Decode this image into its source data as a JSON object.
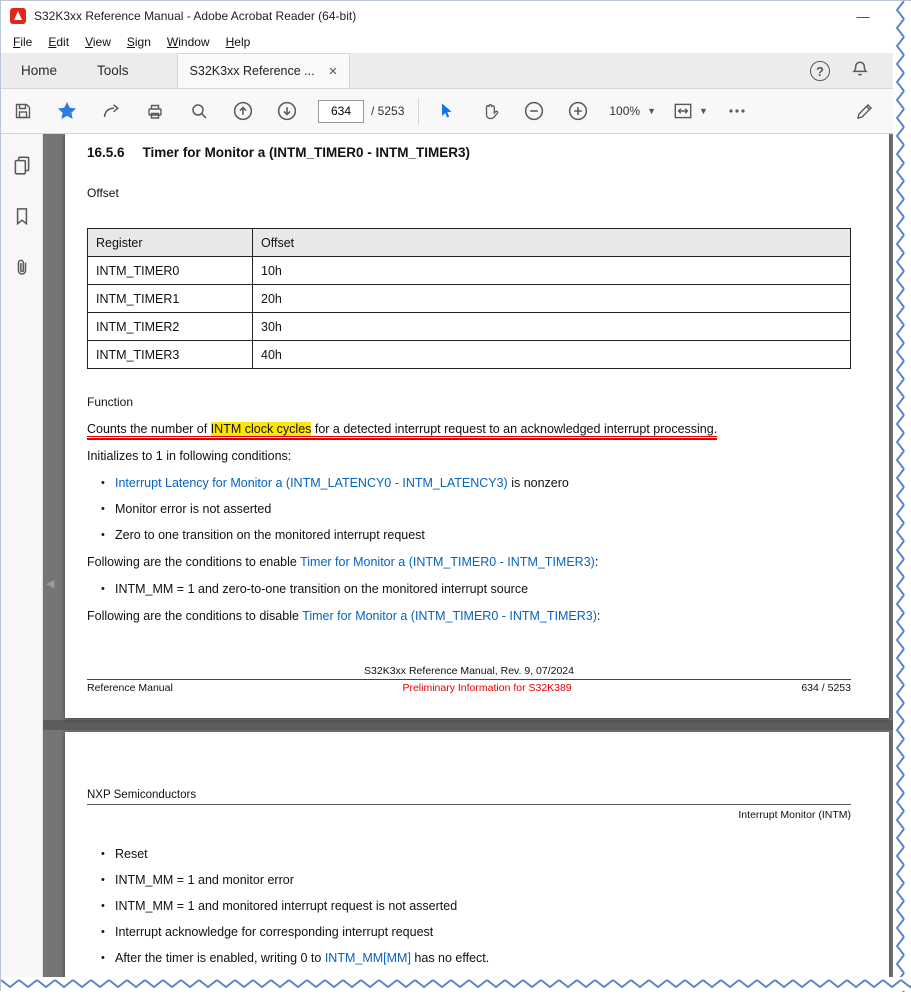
{
  "window": {
    "title": "S32K3xx Reference Manual - Adobe Acrobat Reader (64-bit)"
  },
  "menu": {
    "items": [
      "File",
      "Edit",
      "View",
      "Sign",
      "Window",
      "Help"
    ]
  },
  "tabs": {
    "home": "Home",
    "tools": "Tools",
    "document": "S32K3xx Reference ..."
  },
  "toolbar": {
    "page_current": "634",
    "page_total": "/ 5253",
    "zoom_level": "100%"
  },
  "sidebar": {
    "icons": [
      "page-thumbnails",
      "bookmarks",
      "attachments"
    ]
  },
  "page1": {
    "heading_number": "16.5.6",
    "heading_title": "Timer for Monitor a (INTM_TIMER0 - INTM_TIMER3)",
    "offset_label": "Offset",
    "table": {
      "headers": [
        "Register",
        "Offset"
      ],
      "rows": [
        [
          "INTM_TIMER0",
          "10h"
        ],
        [
          "INTM_TIMER1",
          "20h"
        ],
        [
          "INTM_TIMER2",
          "30h"
        ],
        [
          "INTM_TIMER3",
          "40h"
        ]
      ]
    },
    "function_label": "Function",
    "function_sentence": {
      "pre": "Counts the number of ",
      "highlight": "INTM clock cycles",
      "post": " for a detected interrupt request to an acknowledged interrupt processing."
    },
    "init_line": "Initializes to 1 in following conditions:",
    "bullets1": [
      {
        "pre": "",
        "link": "Interrupt Latency for Monitor a (INTM_LATENCY0 - INTM_LATENCY3)",
        "post": " is nonzero"
      },
      {
        "pre": "Monitor error is not asserted",
        "link": "",
        "post": ""
      },
      {
        "pre": "Zero to one transition on the monitored interrupt request",
        "link": "",
        "post": ""
      }
    ],
    "enable_line": {
      "pre": "Following are the conditions to enable ",
      "link": "Timer for Monitor a (INTM_TIMER0 - INTM_TIMER3)",
      "post": ":"
    },
    "bullets2": [
      {
        "pre": "INTM_MM = 1 and zero-to-one transition on the monitored interrupt source",
        "link": "",
        "post": ""
      }
    ],
    "disable_line": {
      "pre": "Following are the conditions to disable ",
      "link": "Timer for Monitor a (INTM_TIMER0 - INTM_TIMER3)",
      "post": ":"
    },
    "footer_center_top": "S32K3xx Reference Manual, Rev. 9, 07/2024",
    "footer_left": "Reference Manual",
    "footer_center": "Preliminary Information for S32K389",
    "footer_right": "634 / 5253"
  },
  "page2": {
    "header_left": "NXP Semiconductors",
    "header_right": "Interrupt Monitor (INTM)",
    "bullets": [
      {
        "pre": "Reset",
        "link": "",
        "post": ""
      },
      {
        "pre": "INTM_MM = 1 and monitor error",
        "link": "",
        "post": ""
      },
      {
        "pre": "INTM_MM = 1 and monitored interrupt request is not asserted",
        "link": "",
        "post": ""
      },
      {
        "pre": "Interrupt acknowledge for corresponding interrupt request",
        "link": "",
        "post": ""
      },
      {
        "pre": "After the timer is enabled, writing 0 to ",
        "link": "INTM_MM[MM]",
        "post": " has no effect."
      }
    ]
  },
  "colors": {
    "link": "#0563c1",
    "highlight_yellow": "#ffe600",
    "annotation_red": "#e00000",
    "preliminary_red": "#ee0000",
    "accent_blue": "#1473e6",
    "torn_edge_blue": "#5b87c5",
    "doc_background_gray": "#757575"
  }
}
